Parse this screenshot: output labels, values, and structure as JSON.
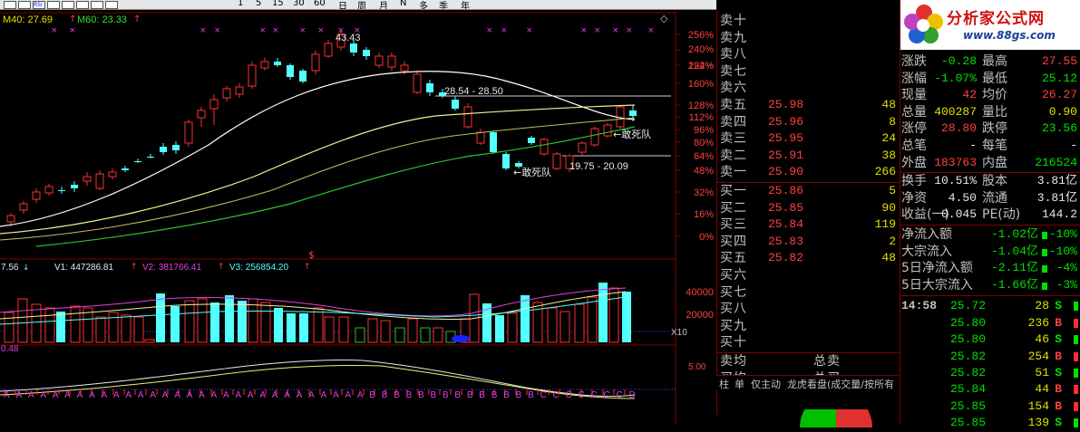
{
  "toolbar": {
    "items": [
      "1",
      "5",
      "15",
      "30",
      "60",
      "日",
      "周",
      "月",
      "N",
      "多",
      "季",
      "年"
    ],
    "icon_names": [
      "chart-line-icon",
      "kline-icon",
      "rsi-icon",
      "zoom-icon",
      "tool-icon",
      "box-icon",
      "box2-icon",
      "window-icon"
    ],
    "icon_labels": [
      "RSI"
    ]
  },
  "main_chart": {
    "ma40_label": "M40: 27.69",
    "ma60_label": "M60: 23.33",
    "high_label": "43.43",
    "band1_label": "28.54 - 28.50",
    "band2_label": "19.75 - 20.09",
    "annotation1": "←敢死队",
    "annotation2": "←敢死队",
    "dollar_label": "$",
    "percent_ticks": [
      "256%",
      "240%",
      "224%",
      "192%",
      "160%",
      "128%",
      "112%",
      "96%",
      "80%",
      "64%",
      "48%",
      "32%",
      "16%",
      "0%"
    ],
    "marker_glyph": "◇"
  },
  "volume_chart": {
    "left_label": "7.56",
    "v1": "V1: 447286.81",
    "v2": "V2: 381766.41",
    "v3": "V3: 256854.20",
    "ticks": [
      "40000",
      "20000"
    ],
    "unit": "X10"
  },
  "indicator_chart": {
    "left_label": "0.48",
    "tick": "5.00",
    "signals": "AAAAAAAAAAAAAAAAAAAAAAAAAAAAAABBBBBBBBBBBBBBCCCCCCCD"
  },
  "order_book": {
    "asks": [
      {
        "label": "卖十",
        "price": "",
        "vol": ""
      },
      {
        "label": "卖九",
        "price": "",
        "vol": ""
      },
      {
        "label": "卖八",
        "price": "",
        "vol": ""
      },
      {
        "label": "卖七",
        "price": "",
        "vol": ""
      },
      {
        "label": "卖六",
        "price": "",
        "vol": ""
      },
      {
        "label": "卖五",
        "price": "25.98",
        "vol": "48"
      },
      {
        "label": "卖四",
        "price": "25.96",
        "vol": "8"
      },
      {
        "label": "卖三",
        "price": "25.95",
        "vol": "24"
      },
      {
        "label": "卖二",
        "price": "25.91",
        "vol": "38"
      },
      {
        "label": "卖一",
        "price": "25.90",
        "vol": "266"
      }
    ],
    "bids": [
      {
        "label": "买一",
        "price": "25.86",
        "vol": "5"
      },
      {
        "label": "买二",
        "price": "25.85",
        "vol": "90"
      },
      {
        "label": "买三",
        "price": "25.84",
        "vol": "119"
      },
      {
        "label": "买四",
        "price": "25.83",
        "vol": "2"
      },
      {
        "label": "买五",
        "price": "25.82",
        "vol": "48"
      },
      {
        "label": "买六",
        "price": "",
        "vol": ""
      },
      {
        "label": "买七",
        "price": "",
        "vol": ""
      },
      {
        "label": "买八",
        "price": "",
        "vol": ""
      },
      {
        "label": "买九",
        "price": "",
        "vol": ""
      },
      {
        "label": "买十",
        "price": "",
        "vol": ""
      }
    ],
    "avg_sell_label": "卖均",
    "avg_buy_label": "买均",
    "total_sell_label": "总卖",
    "total_buy_label": "总买",
    "tabs": [
      "柱",
      "单",
      "仅主动",
      "龙虎看盘(成交量/按所有"
    ]
  },
  "logo": {
    "title": "分析家公式网",
    "url": "www.88gs.com"
  },
  "quote": {
    "rows": [
      {
        "l1": "涨跌",
        "v1": "-0.28",
        "c1": "green",
        "l2": "最高",
        "v2": "27.55",
        "c2": "red"
      },
      {
        "l1": "涨幅",
        "v1": "-1.07%",
        "c1": "green",
        "l2": "最低",
        "v2": "25.12",
        "c2": "green"
      },
      {
        "l1": "现量",
        "v1": "42",
        "c1": "red",
        "l2": "均价",
        "v2": "26.27",
        "c2": "red"
      },
      {
        "l1": "总量",
        "v1": "400287",
        "c1": "yellow",
        "l2": "量比",
        "v2": "0.90",
        "c2": "yellow"
      },
      {
        "l1": "涨停",
        "v1": "28.80",
        "c1": "red",
        "l2": "跌停",
        "v2": "23.56",
        "c2": "green"
      },
      {
        "l1": "总笔",
        "v1": "-",
        "c1": "white",
        "l2": "每笔",
        "v2": "-",
        "c2": "white"
      },
      {
        "l1": "外盘",
        "v1": "183763",
        "c1": "red",
        "l2": "内盘",
        "v2": "216524",
        "c2": "green"
      },
      {
        "l1": "换手",
        "v1": "10.51%",
        "c1": "white",
        "l2": "股本",
        "v2": "3.81亿",
        "c2": "white"
      },
      {
        "l1": "净资",
        "v1": "4.50",
        "c1": "white",
        "l2": "流通",
        "v2": "3.81亿",
        "c2": "white"
      },
      {
        "l1": "收益(一)",
        "v1": "0.045",
        "c1": "white",
        "l2": "PE(动)",
        "v2": "144.2",
        "c2": "white"
      }
    ]
  },
  "flows": [
    {
      "label": "净流入额",
      "value": "-1.02亿",
      "pct": "-10%"
    },
    {
      "label": "大宗流入",
      "value": "-1.04亿",
      "pct": "-10%"
    },
    {
      "label": "5日净流入额",
      "value": "-2.11亿",
      "pct": "-4%"
    },
    {
      "label": "5日大宗流入",
      "value": "-1.66亿",
      "pct": "-3%"
    }
  ],
  "ticks": [
    {
      "time": "14:58",
      "price": "25.72",
      "vol": "28",
      "side": "S"
    },
    {
      "time": "",
      "price": "25.80",
      "vol": "236",
      "side": "B"
    },
    {
      "time": "",
      "price": "25.80",
      "vol": "46",
      "side": "S"
    },
    {
      "time": "",
      "price": "25.82",
      "vol": "254",
      "side": "B"
    },
    {
      "time": "",
      "price": "25.82",
      "vol": "51",
      "side": "S"
    },
    {
      "time": "",
      "price": "25.84",
      "vol": "44",
      "side": "B"
    },
    {
      "time": "",
      "price": "25.85",
      "vol": "154",
      "side": "B"
    },
    {
      "time": "",
      "price": "25.85",
      "vol": "139",
      "side": "S"
    }
  ],
  "colors": {
    "up": "#ff3030",
    "down": "#54ffff",
    "ma_white": "#ffffff",
    "ma_yellow": "#f0f090",
    "ma_green": "#30c030",
    "border": "#800000"
  }
}
